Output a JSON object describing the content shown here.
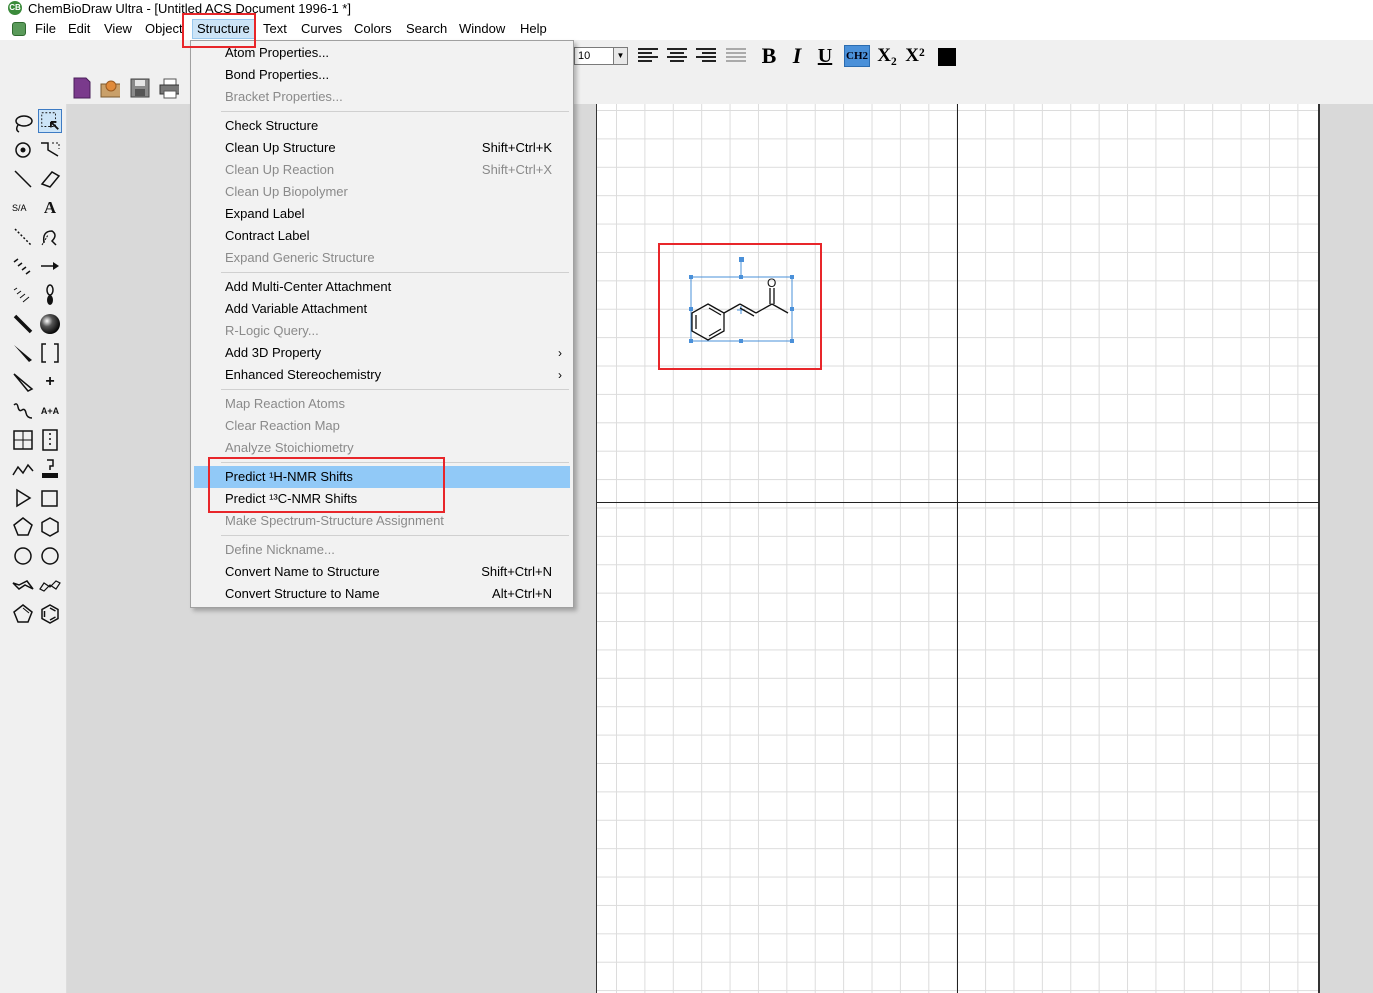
{
  "window": {
    "title": "ChemBioDraw Ultra - [Untitled ACS Document 1996-1 *]"
  },
  "menubar": {
    "items": [
      "File",
      "Edit",
      "View",
      "Object",
      "Structure",
      "Text",
      "Curves",
      "Colors",
      "Search",
      "Window",
      "Help"
    ],
    "active": "Structure"
  },
  "format_toolbar": {
    "font_size": "10",
    "bold": "B",
    "italic": "I",
    "underline": "U",
    "formula": "CH2",
    "subscript": "X₂",
    "superscript": "X²"
  },
  "structure_menu": {
    "items": [
      {
        "label": "Atom Properties...",
        "disabled": false
      },
      {
        "label": "Bond Properties...",
        "disabled": false
      },
      {
        "label": "Bracket Properties...",
        "disabled": true
      },
      {
        "label": "Check Structure",
        "disabled": false
      },
      {
        "label": "Clean Up Structure",
        "shortcut": "Shift+Ctrl+K",
        "disabled": false
      },
      {
        "label": "Clean Up Reaction",
        "shortcut": "Shift+Ctrl+X",
        "disabled": true
      },
      {
        "label": "Clean Up Biopolymer",
        "disabled": true
      },
      {
        "label": "Expand Label",
        "disabled": false
      },
      {
        "label": "Contract Label",
        "disabled": false
      },
      {
        "label": "Expand Generic Structure",
        "disabled": true
      },
      {
        "label": "Add Multi-Center Attachment",
        "disabled": false
      },
      {
        "label": "Add Variable Attachment",
        "disabled": false
      },
      {
        "label": "R-Logic Query...",
        "disabled": true
      },
      {
        "label": "Add 3D Property",
        "submenu": true,
        "disabled": false
      },
      {
        "label": "Enhanced Stereochemistry",
        "submenu": true,
        "disabled": false
      },
      {
        "label": "Map Reaction Atoms",
        "disabled": true
      },
      {
        "label": "Clear Reaction Map",
        "disabled": true
      },
      {
        "label": "Analyze Stoichiometry",
        "disabled": true
      },
      {
        "label": "Predict ¹H-NMR Shifts",
        "disabled": false,
        "highlighted": true
      },
      {
        "label": "Predict ¹³C-NMR Shifts",
        "disabled": false
      },
      {
        "label": "Make Spectrum-Structure Assignment",
        "disabled": true
      },
      {
        "label": "Define Nickname...",
        "disabled": true
      },
      {
        "label": "Convert Name to Structure",
        "shortcut": "Shift+Ctrl+N",
        "disabled": false
      },
      {
        "label": "Convert Structure to Name",
        "shortcut": "Alt+Ctrl+N",
        "disabled": false
      }
    ],
    "submenu_arrow": "›"
  },
  "palette": {
    "tools": [
      "lasso-icon",
      "marquee-icon",
      "rotate-icon",
      "structure-perspective-icon",
      "solid-bond-icon",
      "eraser-icon",
      "stereo-bond-icon",
      "text-icon",
      "dashed-bond-icon",
      "mass-fragment-icon",
      "hashed-bond-icon",
      "arrow-icon",
      "hashed-wedge-icon",
      "orbital-icon",
      "bold-bond-icon",
      "sphere-icon",
      "wedge-bond-icon",
      "bracket-icon",
      "hollow-wedge-icon",
      "charge-icon",
      "wavy-bond-icon",
      "reaction-map-icon",
      "table-icon",
      "tlc-plate-icon",
      "chain-icon",
      "template-icon",
      "play-icon",
      "rectangle-icon",
      "pentagon-icon",
      "hexagon-icon",
      "circle-icon",
      "cyclohexane-icon",
      "cyclopentane-chair-icon",
      "chair-icon",
      "cyclopentadiene-icon",
      "benzene-icon"
    ],
    "text_tool_label": "A",
    "reaction_map_label": "A+A",
    "charge_label": "+"
  },
  "molecule": {
    "oxygen_label": "O"
  },
  "colors": {
    "accent": "#91c9f7",
    "selection": "#4a90d9",
    "annotation": "#e8262a"
  }
}
